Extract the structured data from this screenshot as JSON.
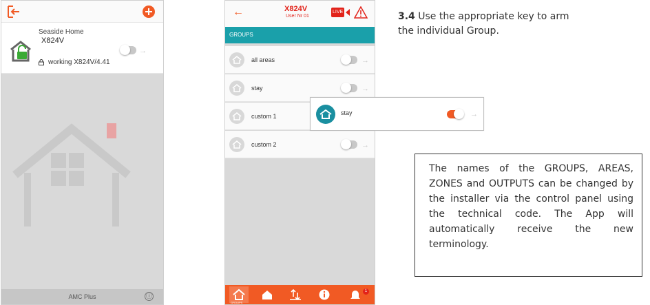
{
  "left_phone": {
    "site": {
      "name": "Seaside Home",
      "model": "X824V",
      "status": "working X824V/4.41"
    },
    "footer": {
      "app_name": "AMC Plus",
      "info_glyph": "ⓘ"
    },
    "icons": [
      "exit-icon",
      "add-icon",
      "house-unlocked-icon",
      "lock-icon",
      "house-placeholder-icon",
      "info-icon"
    ]
  },
  "right_phone": {
    "header": {
      "back_glyph": "←",
      "title": "X824V",
      "user": "User Nr  01",
      "live": "LIVE"
    },
    "section_label": "GROUPS",
    "groups": [
      {
        "label": "all areas",
        "armed": false
      },
      {
        "label": "stay",
        "armed": false
      },
      {
        "label": "custom 1",
        "armed": false
      },
      {
        "label": "custom 2",
        "armed": false
      }
    ],
    "navbar": {
      "active_caption": "GROUPS",
      "badge_count": "1",
      "icons": [
        "groups-icon",
        "areas-icon",
        "outputs-icon",
        "info-icon",
        "alarm-bell-icon"
      ]
    }
  },
  "popup": {
    "label": "stay",
    "armed": true
  },
  "instruction": {
    "step": "3.4",
    "text": " Use the appropriate key to arm the individual Group."
  },
  "note": {
    "text": "The names of the GROUPS, AREAS, ZONES and OUTPUTS can be changed by the installer via the control panel using the technical code. The App will automatically receive the new terminology."
  },
  "colors": {
    "accent": "#f15a24",
    "teal": "#1aa0aa",
    "alert_red": "#e2231a"
  }
}
